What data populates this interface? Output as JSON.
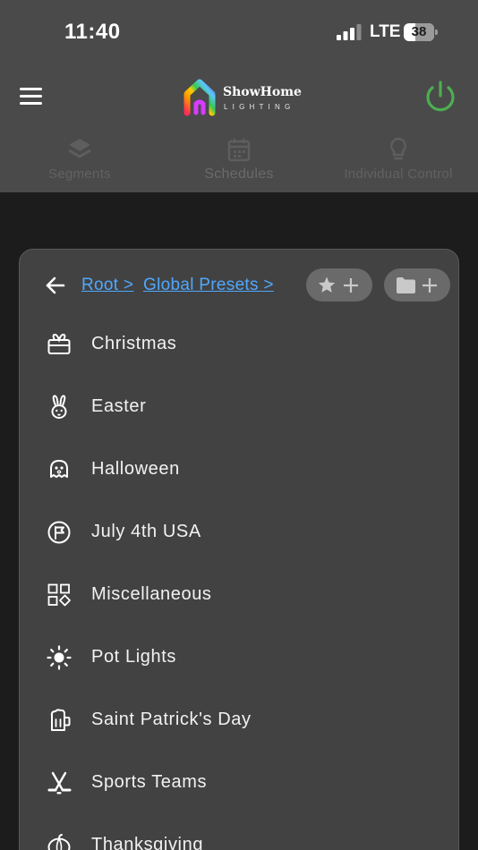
{
  "status_bar": {
    "time": "11:40",
    "network": "LTE",
    "battery_percent": "38",
    "battery_level": 0.38,
    "signal_bars": 3
  },
  "app_bar": {
    "brand_name": "ShowHome",
    "brand_sub": "LIGHTING",
    "power_color": "#4caf50"
  },
  "tabs": [
    {
      "label": "Segments",
      "icon": "layers-icon"
    },
    {
      "label": "Schedules",
      "icon": "calendar-icon"
    },
    {
      "label": "Individual Control",
      "icon": "bulb-icon"
    }
  ],
  "breadcrumb": {
    "items": [
      "Root >",
      "Global Presets >"
    ]
  },
  "actions": {
    "favorite_add_icon": "star-plus-icon",
    "folder_add_icon": "folder-plus-icon"
  },
  "preset_folders": [
    {
      "label": "Christmas",
      "icon": "gift-icon"
    },
    {
      "label": "Easter",
      "icon": "bunny-icon"
    },
    {
      "label": "Halloween",
      "icon": "ghost-icon"
    },
    {
      "label": "July 4th USA",
      "icon": "flag-icon"
    },
    {
      "label": "Miscellaneous",
      "icon": "shapes-icon"
    },
    {
      "label": "Pot Lights",
      "icon": "sun-icon"
    },
    {
      "label": "Saint Patrick's Day",
      "icon": "beer-mug-icon"
    },
    {
      "label": "Sports Teams",
      "icon": "hockey-icon"
    },
    {
      "label": "Thanksgiving",
      "icon": "pumpkin-icon"
    }
  ],
  "colors": {
    "accent_link": "#4fa8ff",
    "power": "#4caf50",
    "header_bg": "#4a4a4a",
    "panel_bg": "#424242"
  }
}
